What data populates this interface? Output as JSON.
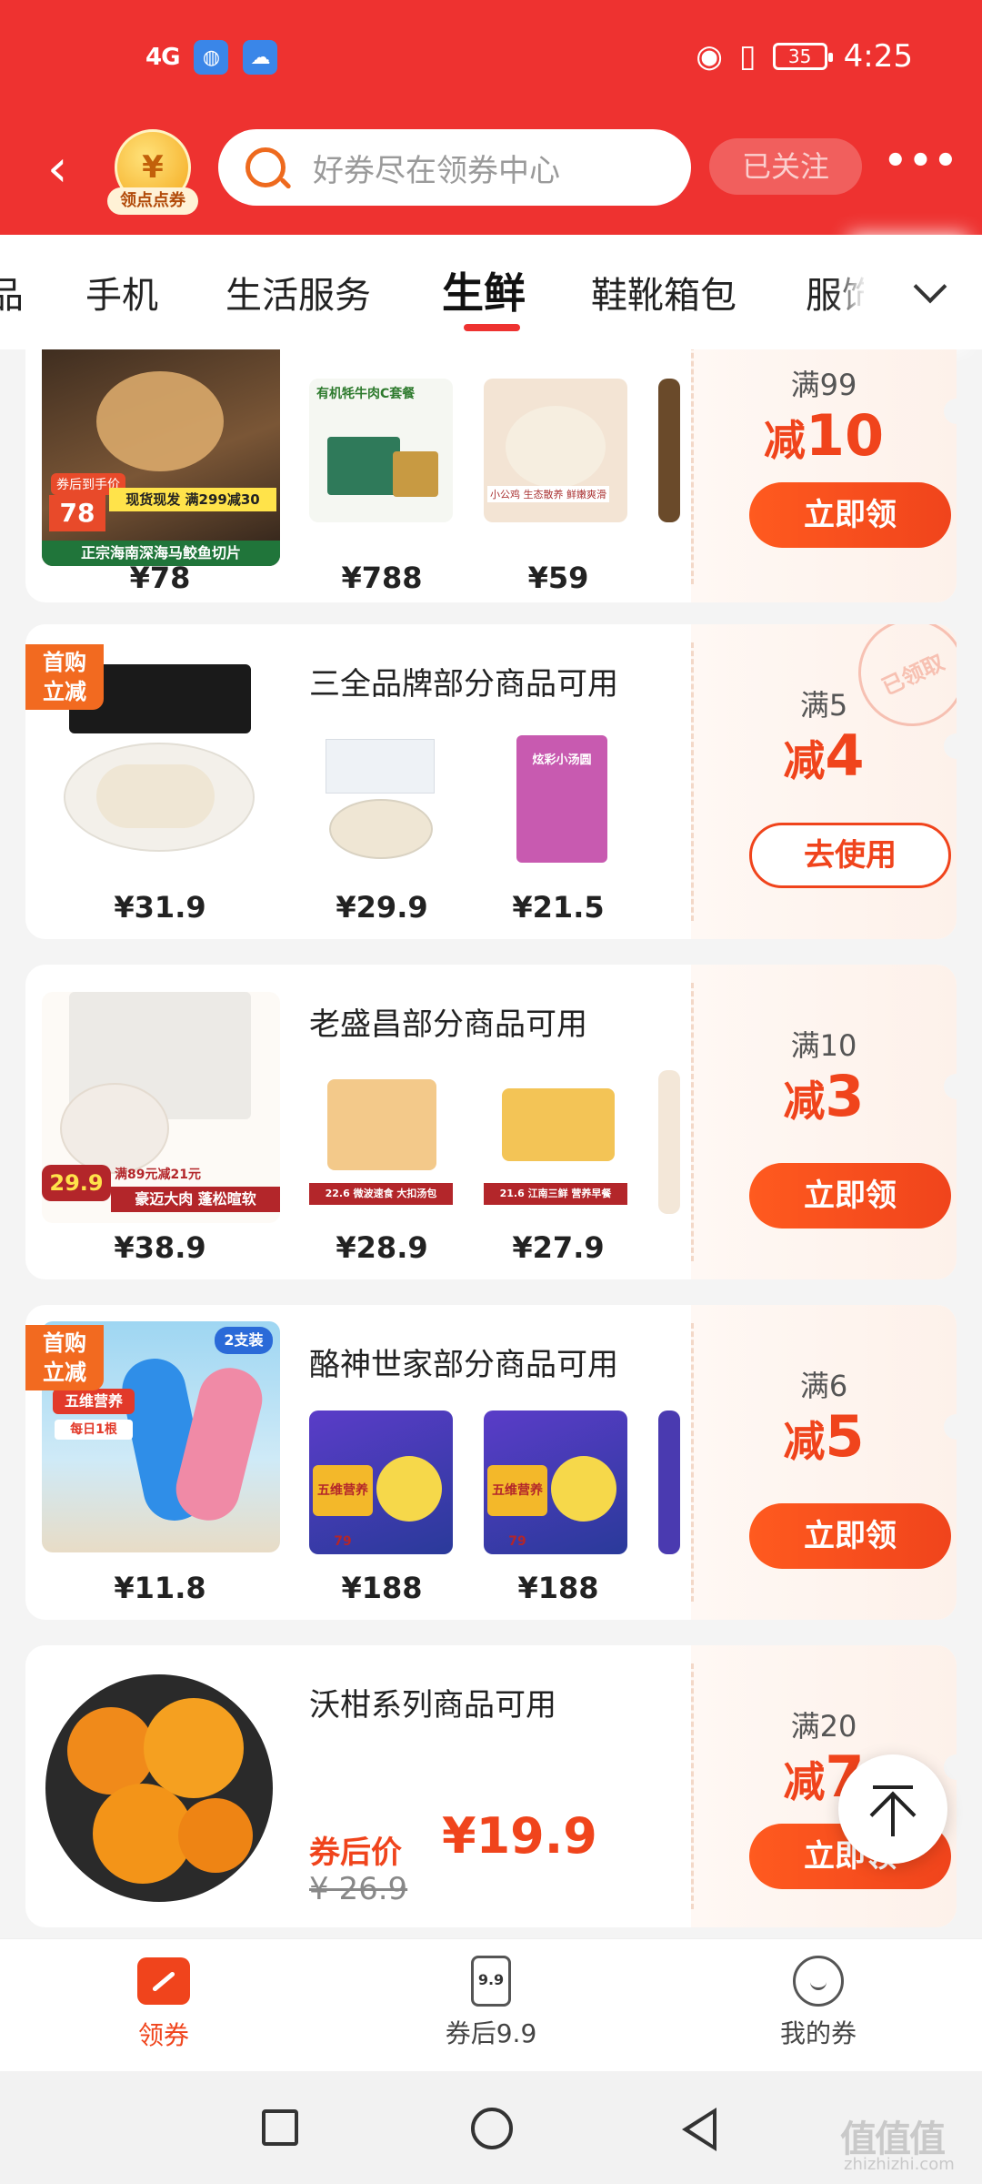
{
  "status_bar": {
    "signal": "4G",
    "battery": "35",
    "time": "4:25"
  },
  "toolbar": {
    "badge_label": "领点点券",
    "badge_symbol": "¥",
    "search_placeholder": "好券尽在领券中心",
    "follow_label": "已关注",
    "more_label": "•••"
  },
  "tabs": [
    {
      "label": "品"
    },
    {
      "label": "手机"
    },
    {
      "label": "生活服务"
    },
    {
      "label": "生鲜"
    },
    {
      "label": "鞋靴箱包"
    },
    {
      "label": "服饰"
    }
  ],
  "cards": [
    {
      "title": "",
      "condition": "满99",
      "discount_prefix": "减",
      "discount_value": "10",
      "button": "立即领",
      "main_price": "¥78",
      "thumb_prices": [
        "¥788",
        "¥59"
      ],
      "main_img_text": [
        "券后到手价",
        "78",
        "现货现发 满299减30",
        "正宗海南深海马鲛鱼切片"
      ],
      "thumb_texts": [
        "有机牦牛肉C套餐",
        "小公鸡 生态散养 鲜嫩爽滑"
      ]
    },
    {
      "title": "三全品牌部分商品可用",
      "condition": "满5",
      "discount_prefix": "减",
      "discount_value": "4",
      "button": "去使用",
      "tag": [
        "首购",
        "立减"
      ],
      "stamp": "已领取",
      "main_price": "¥31.9",
      "thumb_prices": [
        "¥29.9",
        "¥21.5"
      ],
      "thumb_texts": [
        "",
        "炫彩小汤圆"
      ]
    },
    {
      "title": "老盛昌部分商品可用",
      "condition": "满10",
      "discount_prefix": "减",
      "discount_value": "3",
      "button": "立即领",
      "main_price": "¥38.9",
      "thumb_prices": [
        "¥28.9",
        "¥27.9"
      ],
      "main_img_text": [
        "29.9",
        "满89元减21元",
        "豪迈大肉 蓬松暄软"
      ],
      "thumb_texts": [
        "22.6 微波速食 大扣汤包",
        "21.6 江南三鲜 营养早餐"
      ]
    },
    {
      "title": "酪神世家部分商品可用",
      "condition": "满6",
      "discount_prefix": "减",
      "discount_value": "5",
      "button": "立即领",
      "tag": [
        "首购",
        "立减"
      ],
      "main_price": "¥11.8",
      "thumb_prices": [
        "¥188",
        "¥188"
      ],
      "main_img_text": [
        "2支装",
        "五维营养",
        "每日1根"
      ],
      "thumb_texts": [
        "五维营养 79",
        "五维营养 79"
      ]
    },
    {
      "title": "沃柑系列商品可用",
      "condition": "满20",
      "discount_prefix": "减",
      "discount_value": "7",
      "button": "立即领",
      "after_label": "券后价",
      "after_price": "¥19.9",
      "orig_price": "¥ 26.9"
    }
  ],
  "bottom_nav": [
    {
      "label": "领券",
      "icon": "coupon-icon"
    },
    {
      "label": "券后9.9",
      "icon": "ticket-icon",
      "icon_text": "9.9"
    },
    {
      "label": "我的券",
      "icon": "smile-icon"
    }
  ],
  "watermark": {
    "main": "值值值",
    "sub": "zhizhizhi.com"
  },
  "colors": {
    "header": "#ee3230",
    "accent": "#f0441c"
  }
}
